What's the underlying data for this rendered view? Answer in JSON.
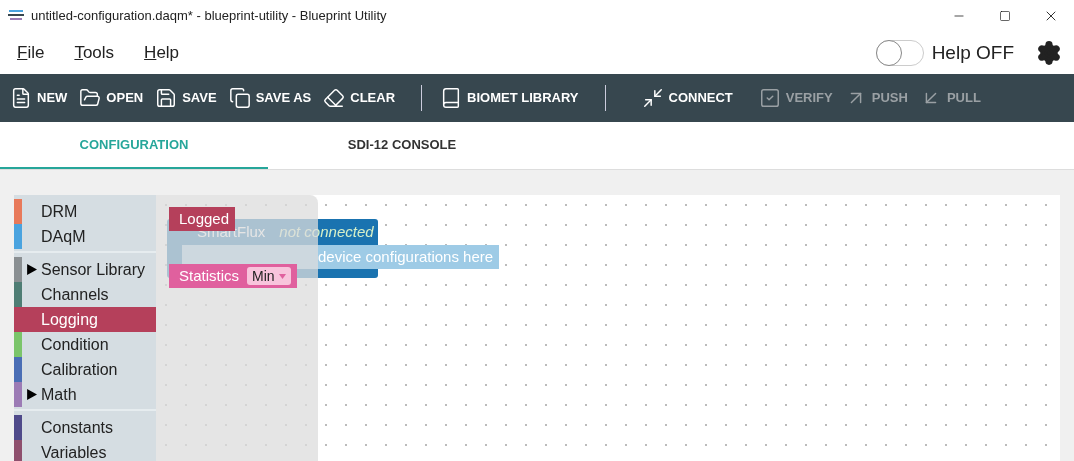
{
  "window": {
    "title": "untitled-configuration.daqm* - blueprint-utility - Blueprint Utility"
  },
  "menu": [
    {
      "label": "File"
    },
    {
      "label": "Tools"
    },
    {
      "label": "Help"
    }
  ],
  "help_toggle": {
    "label": "Help OFF",
    "on": false
  },
  "toolbar": [
    [
      {
        "kind": "new",
        "label": "NEW",
        "disabled": false
      },
      {
        "kind": "open",
        "label": "OPEN",
        "disabled": false
      },
      {
        "kind": "save",
        "label": "SAVE",
        "disabled": false
      },
      {
        "kind": "saveas",
        "label": "SAVE AS",
        "disabled": false
      },
      {
        "kind": "clear",
        "label": "CLEAR",
        "disabled": false
      }
    ],
    [
      {
        "kind": "library",
        "label": "BIOMET LIBRARY",
        "disabled": false
      }
    ],
    [
      {
        "kind": "connect",
        "label": "CONNECT",
        "disabled": false
      },
      {
        "kind": "verify",
        "label": "VERIFY",
        "disabled": true
      },
      {
        "kind": "push",
        "label": "PUSH",
        "disabled": true
      },
      {
        "kind": "pull",
        "label": "PULL",
        "disabled": true
      }
    ]
  ],
  "tabs": [
    {
      "label": "CONFIGURATION",
      "selected": true
    },
    {
      "label": "SDI-12 CONSOLE",
      "selected": false
    }
  ],
  "toolbox": [
    [
      {
        "label": "DRM",
        "color": "#e8795a",
        "selected": false
      },
      {
        "label": "DAqM",
        "color": "#4aa3df",
        "selected": false
      }
    ],
    [
      {
        "label": "Sensor Library",
        "color": "#8a8f92",
        "selected": false,
        "expanded": false
      },
      {
        "label": "Channels",
        "color": "#4e7d74",
        "selected": false
      },
      {
        "label": "Logging",
        "color": "#b5405b",
        "selected": true
      },
      {
        "label": "Condition",
        "color": "#7bc56a",
        "selected": false
      },
      {
        "label": "Calibration",
        "color": "#4a6eb5",
        "selected": false
      },
      {
        "label": "Math",
        "color": "#9c7bb5",
        "selected": false,
        "expanded": false
      }
    ],
    [
      {
        "label": "Constants",
        "color": "#4f4a8a",
        "selected": false
      },
      {
        "label": "Variables",
        "color": "#8e4f6d",
        "selected": false
      }
    ]
  ],
  "canvas": {
    "device_block": {
      "name": "SmartFlux",
      "status": "not connected",
      "hint": "device configurations here"
    }
  },
  "flyout": [
    {
      "label": "Logged",
      "color": "#b5405b"
    },
    {
      "label": "Statistics",
      "color": "#e0609e",
      "dropdown": "Min"
    }
  ]
}
